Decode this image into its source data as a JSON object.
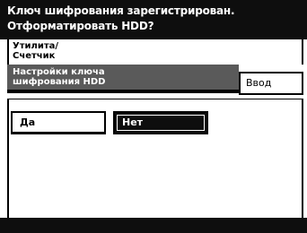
{
  "message": {
    "line1": "Ключ шифрования зарегистрирован.",
    "line2": "Отформатировать HDD?"
  },
  "breadcrumb": {
    "line1": "Утилита/",
    "line2": "Счетчик"
  },
  "section": {
    "line1": "Настройки ключа",
    "line2": "шифрования HDD"
  },
  "buttons": {
    "enter": "Ввод",
    "yes": "Да",
    "no": "Нет"
  },
  "colors": {
    "bar": "#0e0e0e",
    "header": "#5a5a5a",
    "background": "#ffffff"
  }
}
